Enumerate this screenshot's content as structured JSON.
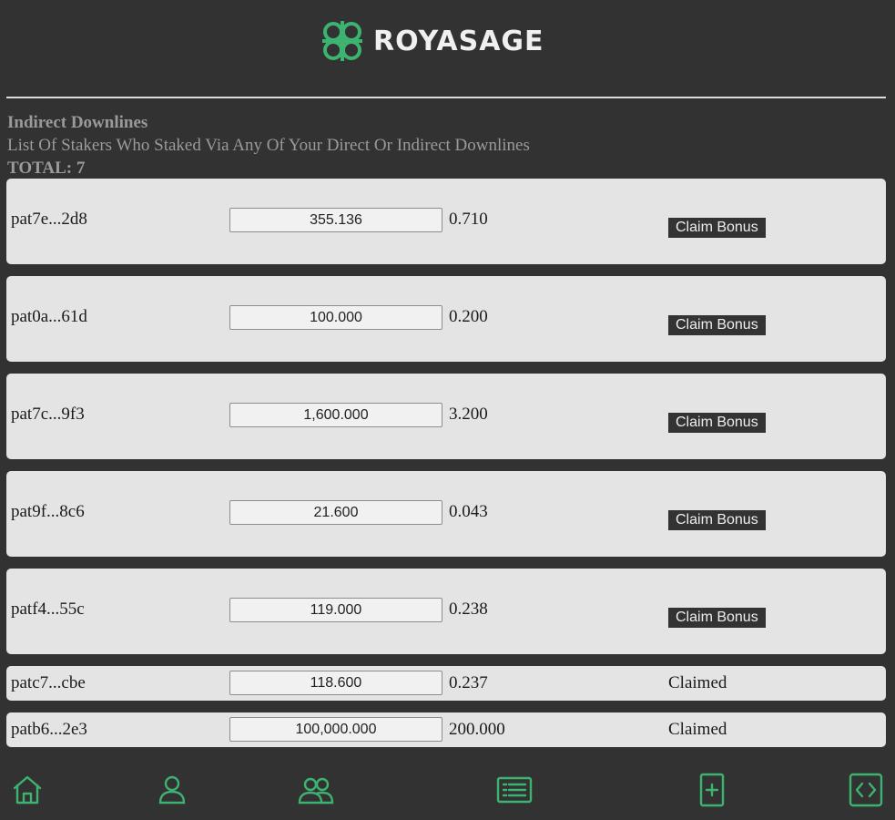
{
  "brand": {
    "name": "ROYASAGE",
    "accent": "#3cb371"
  },
  "section": {
    "title": "Indirect Downlines",
    "subtitle": "List Of Stakers Who Staked Via Any Of Your Direct Or Indirect Downlines",
    "total": "TOTAL: 7"
  },
  "rows": [
    {
      "address": "pat7e...2d8",
      "amount": "355.136",
      "bonus": "0.710",
      "action": "Claim Bonus",
      "claimed": false
    },
    {
      "address": "pat0a...61d",
      "amount": "100.000",
      "bonus": "0.200",
      "action": "Claim Bonus",
      "claimed": false
    },
    {
      "address": "pat7c...9f3",
      "amount": "1,600.000",
      "bonus": "3.200",
      "action": "Claim Bonus",
      "claimed": false
    },
    {
      "address": "pat9f...8c6",
      "amount": "21.600",
      "bonus": "0.043",
      "action": "Claim Bonus",
      "claimed": false
    },
    {
      "address": "patf4...55c",
      "amount": "119.000",
      "bonus": "0.238",
      "action": "Claim Bonus",
      "claimed": false
    },
    {
      "address": "patc7...cbe",
      "amount": "118.600",
      "bonus": "0.237",
      "action": "Claimed",
      "claimed": true
    },
    {
      "address": "patb6...2e3",
      "amount": "100,000.000",
      "bonus": "200.000",
      "action": "Claimed",
      "claimed": true
    }
  ],
  "nav": [
    {
      "icon": "home-icon"
    },
    {
      "icon": "user-icon"
    },
    {
      "icon": "users-icon"
    },
    {
      "icon": "list-icon"
    },
    {
      "icon": "add-document-icon"
    },
    {
      "icon": "code-icon"
    }
  ]
}
